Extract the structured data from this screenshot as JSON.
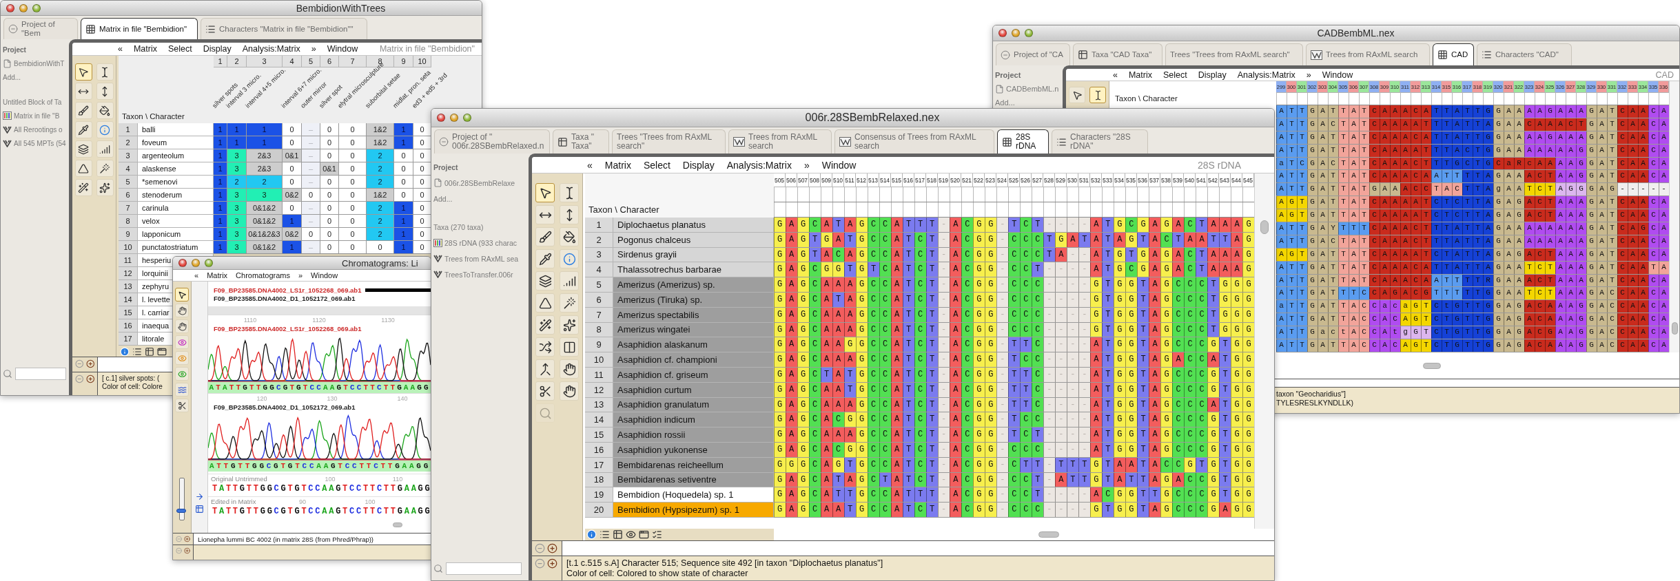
{
  "bembidion_window": {
    "title": "BembidionWithTrees",
    "tabs": [
      {
        "kind": "project",
        "label": "Project of \"Bem",
        "selected": false
      },
      {
        "kind": "matrix",
        "label": "Matrix in file \"Bembidion\"",
        "selected": true
      },
      {
        "kind": "characters",
        "label": "Characters \"Matrix in file \"Bembidion\"\"",
        "selected": false
      }
    ],
    "project_pane": [
      {
        "kind": "title",
        "label": "Project"
      },
      {
        "kind": "file",
        "label": "BembidionWithT"
      },
      {
        "kind": "add",
        "label": "Add..."
      },
      {
        "kind": "heading",
        "label": "Untitled Block of Ta"
      },
      {
        "kind": "matrix",
        "label": "Matrix in file \"B"
      },
      {
        "kind": "trees",
        "label": "All Rerootings o"
      },
      {
        "kind": "trees",
        "label": "All 545 MPTs (54"
      }
    ],
    "menu": {
      "items": [
        "«",
        "Matrix",
        "Select",
        "Display",
        "Analysis:Matrix",
        "»",
        "Window"
      ],
      "label": "Matrix in file \"Bembidion\""
    },
    "tools": [
      {
        "selected": true
      },
      {
        "selected": false
      },
      {
        "selected": false
      },
      {
        "selected": false
      },
      {
        "selected": false
      },
      {
        "selected": false
      },
      {
        "selected": false
      },
      {
        "selected": false
      },
      {
        "selected": false
      },
      {
        "selected": false
      },
      {
        "selected": false
      },
      {
        "selected": false
      },
      {
        "selected": false
      },
      {
        "selected": false
      }
    ],
    "matrix": {
      "corner": "Taxon \\ Character",
      "columns": [
        {
          "number": "1",
          "name": "silver spots"
        },
        {
          "number": "2",
          "name": "interval 3 micro."
        },
        {
          "number": "3",
          "name": "interval 4+5 micro."
        },
        {
          "number": "4",
          "name": "interval 6+7 micro."
        },
        {
          "number": "5",
          "name": "outer mirror"
        },
        {
          "number": "6",
          "name": "silver spot"
        },
        {
          "number": "7",
          "name": "elytral microsculpture"
        },
        {
          "number": "8",
          "name": "suborbital setae"
        },
        {
          "number": "9",
          "name": "midlat. pron. seta"
        },
        {
          "number": "10",
          "name": "ed3 + ed5 + 3rd"
        }
      ],
      "rows": [
        {
          "number": "1",
          "name": "balli",
          "cells": [
            "1",
            "1",
            "1",
            "0",
            "–",
            "0",
            "0",
            "1&2",
            "1",
            "0"
          ]
        },
        {
          "number": "2",
          "name": "foveum",
          "cells": [
            "1",
            "1",
            "1",
            "0",
            "–",
            "0",
            "0",
            "1&2",
            "1",
            "0"
          ]
        },
        {
          "number": "3",
          "name": "argenteolum",
          "cells": [
            "1",
            "3",
            "2&3",
            "0&1",
            "–",
            "0",
            "0",
            "2",
            "0",
            "0"
          ]
        },
        {
          "number": "4",
          "name": "alaskense",
          "cells": [
            "1",
            "3",
            "2&3",
            "0",
            "–",
            "0&1",
            "0",
            "2",
            "0",
            "0"
          ]
        },
        {
          "number": "5",
          "name": "*semenovi",
          "cells": [
            "1",
            "2",
            "2",
            "0",
            "–",
            "0",
            "0",
            "2",
            "0",
            "0"
          ]
        },
        {
          "number": "6",
          "name": "stenoderum",
          "cells": [
            "1",
            "3",
            "3",
            "0&2",
            "0",
            "0",
            "0",
            "1&2",
            "0",
            "0"
          ]
        },
        {
          "number": "7",
          "name": "carinula",
          "cells": [
            "1",
            "3",
            "0&1&2",
            "0",
            "–",
            "0",
            "0",
            "2",
            "1",
            "0"
          ]
        },
        {
          "number": "8",
          "name": "velox",
          "cells": [
            "1",
            "3",
            "0&1&2",
            "1",
            "–",
            "0",
            "0",
            "2",
            "1",
            "0"
          ]
        },
        {
          "number": "9",
          "name": "lapponicum",
          "cells": [
            "1",
            "3",
            "0&1&2&3",
            "0&2",
            "0",
            "0",
            "0",
            "2",
            "1",
            "0"
          ]
        },
        {
          "number": "10",
          "name": "punctatostriatum",
          "cells": [
            "1",
            "3",
            "0&1&2",
            "1",
            "–",
            "0",
            "0",
            "0",
            "1",
            "0"
          ]
        },
        {
          "number": "11",
          "name": "hesperiu"
        },
        {
          "number": "12",
          "name": "lorquinii"
        },
        {
          "number": "13",
          "name": "zephyru"
        },
        {
          "number": "14",
          "name": "l. levette"
        },
        {
          "number": "15",
          "name": "l. carriar"
        },
        {
          "number": "16",
          "name": "inaequa"
        },
        {
          "number": "17",
          "name": "litorale"
        }
      ]
    },
    "status": [
      "[ c.1] silver spots:  (",
      "Color of cell: Colore"
    ]
  },
  "chromatogram_window": {
    "title": "Chromatograms: Li",
    "menu": {
      "items": [
        "«",
        "Matrix",
        "Chromatograms",
        "»",
        "Window"
      ]
    },
    "tools": [
      {
        "selected": true
      },
      {
        "selected": false
      },
      {
        "selected": false
      },
      {
        "selected": false
      },
      {
        "selected": false
      },
      {
        "selected": false
      },
      {
        "selected": false
      },
      {
        "selected": false
      }
    ],
    "zoom_slider": {
      "level": 0.22
    },
    "files": [
      {
        "name": "F09_BP23585.DNA4002_LS1r_1052268_069.ab1",
        "color": "#cc2a2a"
      },
      {
        "name": "F09_BP23585.DNA4002_D1_1052172_069.ab1",
        "color": "#1e1e1e"
      }
    ],
    "traces": [
      {
        "label": "F09_BP23585.DNA4002_LS1r_1052268_069.ab1",
        "color": "#cc2a2a",
        "ticks": [
          "1110",
          "1120",
          "1130"
        ],
        "bases": "ATATTGTTGGCGTGTCCAAGTCCTTCTTGAAGG"
      },
      {
        "label": "F09_BP23585.DNA4002_D1_1052172_069.ab1",
        "color": "#1e1e1e",
        "ticks": [
          "120",
          "130",
          "140"
        ],
        "bases": "ATTGTTGGCGTGTCCAAGTCCTTCTTGAAGG"
      }
    ],
    "sequences": [
      {
        "label": "Original Untrimmed",
        "ticks": [
          "100",
          "110"
        ],
        "bases": "TATTGTTGGCGTGTCCAAGTCCTTCTTGAAGG"
      },
      {
        "label": "Edited in Matrix",
        "ticks": [
          "90",
          "100"
        ],
        "bases": "TATTGTTGGCGTGTCCAAGTCCTTCTTGAAGG"
      }
    ],
    "status": "Lionepha lummi BC 4002 (in matrix 28S (from Phred/Phrap))"
  },
  "rdna_window": {
    "title": "006r.28SBembRelaxed.nex",
    "tabs": [
      {
        "kind": "project",
        "label": "Project of \" 006r.28SBembRelaxed.n",
        "selected": false
      },
      {
        "kind": "taxa",
        "label": "Taxa \" Taxa\"",
        "selected": false
      },
      {
        "kind": "trees",
        "label": "Trees \"Trees from RAxML search\"",
        "selected": false
      },
      {
        "kind": "tree_window",
        "label": "Trees from RAxML search",
        "selected": false
      },
      {
        "kind": "tree_window",
        "label": "Consensus of Trees from RAxML search",
        "selected": false
      },
      {
        "kind": "matrix",
        "label": "28S rDNA",
        "selected": true
      },
      {
        "kind": "characters",
        "label": "Characters \"28S rDNA\"",
        "selected": false
      }
    ],
    "project_pane": [
      {
        "kind": "title",
        "label": "Project"
      },
      {
        "kind": "file",
        "label": "006r.28SBembRelaxe"
      },
      {
        "kind": "add",
        "label": "Add..."
      },
      {
        "kind": "heading",
        "label": "Taxa (270 taxa)"
      },
      {
        "kind": "matrix",
        "label": "28S rDNA (933 charac"
      },
      {
        "kind": "trees",
        "label": "Trees from RAxML sea"
      },
      {
        "kind": "trees",
        "label": "TreesToTransfer.006r"
      }
    ],
    "menu": {
      "items": [
        "«",
        "Matrix",
        "Select",
        "Display",
        "Analysis:Matrix",
        "»",
        "Window"
      ],
      "label": "28S rDNA"
    },
    "tools": [
      {
        "selected": true,
        "disabled": false
      },
      {
        "selected": false,
        "disabled": false
      },
      {
        "selected": false,
        "disabled": false
      },
      {
        "selected": false,
        "disabled": false
      },
      {
        "selected": false,
        "disabled": false
      },
      {
        "selected": false,
        "disabled": false
      },
      {
        "selected": false,
        "disabled": false
      },
      {
        "selected": false,
        "disabled": false
      },
      {
        "selected": false,
        "disabled": false
      },
      {
        "selected": false,
        "disabled": false
      },
      {
        "selected": false,
        "disabled": false
      },
      {
        "selected": false,
        "disabled": false
      },
      {
        "selected": false,
        "disabled": false
      },
      {
        "selected": false,
        "disabled": false
      },
      {
        "selected": false,
        "disabled": false
      },
      {
        "selected": false,
        "disabled": false
      },
      {
        "selected": false,
        "disabled": false
      },
      {
        "selected": false,
        "disabled": false
      },
      {
        "selected": false,
        "disabled": false
      },
      {
        "selected": false,
        "disabled": false
      },
      {
        "selected": false,
        "disabled": true
      }
    ],
    "matrix": {
      "corner": "Taxon \\ Character",
      "column_numbers": [
        "505",
        "506",
        "507",
        "508",
        "509",
        "510",
        "511",
        "512",
        "513",
        "514",
        "515",
        "516",
        "517",
        "518",
        "519",
        "520",
        "521",
        "522",
        "523",
        "524",
        "525",
        "526",
        "527",
        "528",
        "529",
        "530",
        "531",
        "532",
        "533",
        "534",
        "535",
        "536",
        "537",
        "538",
        "539",
        "540",
        "541",
        "542",
        "543",
        "544",
        "545"
      ],
      "rows": [
        {
          "number": "1",
          "name": "Diplochaetus planatus",
          "color": "#d6d6d6",
          "sequence": "GAGCATAGCCATTT-ACGG-TCT----ATGCGAGACTAAAG"
        },
        {
          "number": "2",
          "name": "Pogonus chalceus",
          "color": "#d6d6d6",
          "sequence": "GAGTGATGCCATCT-ACGG-CCCTGATATAGTACTAATTAG"
        },
        {
          "number": "3",
          "name": "Sirdenus grayii",
          "color": "#d6d6d6",
          "sequence": "GAGTACAGCCATCT-ACGG-CCCTA--ATGTGAGACTAAAG"
        },
        {
          "number": "4",
          "name": "Thalassotrechus barbarae",
          "color": "#d6d6d6",
          "sequence": "GAGCGGTGTCATCT-ACGG-CCT----ATGCGAGACTAAAG"
        },
        {
          "number": "5",
          "name": "Amerizus (Amerizus) sp.",
          "color": "#9e9e9e",
          "sequence": "GAGCAAAGCCATCT-ACGG-CCC----GTGGTAGCCCTGGG"
        },
        {
          "number": "6",
          "name": "Amerizus (Tiruka) sp.",
          "color": "#9e9e9e",
          "sequence": "GAGCATAGCCATCT-ACGG-CCC----GTGGTAGCCCTGGG"
        },
        {
          "number": "7",
          "name": "Amerizus spectabilis",
          "color": "#9e9e9e",
          "sequence": "GAGCAAAGCCATCT-ACGG-CCC----GTGGTAGCCCTGGG"
        },
        {
          "number": "8",
          "name": "Amerizus wingatei",
          "color": "#9e9e9e",
          "sequence": "GAGCAAAGCCATCT-ACGG-CCC----GTGGTAGCCCTGGG"
        },
        {
          "number": "9",
          "name": "Asaphidion alaskanum",
          "color": "#9e9e9e",
          "sequence": "GAGCAAGGCCATCT-ACGG-TTC----ATGGTAGCCCGTGG"
        },
        {
          "number": "10",
          "name": "Asaphidion cf. championi",
          "color": "#9e9e9e",
          "sequence": "GAGCAAAGCCATCT-ACGG-TCC----ATGGTAGACCATGG"
        },
        {
          "number": "11",
          "name": "Asaphidion cf. griseum",
          "color": "#9e9e9e",
          "sequence": "GAGCTATGCCATCT-ACGG-TTC----ATGGTAGCCCGTGG"
        },
        {
          "number": "12",
          "name": "Asaphidion curtum",
          "color": "#9e9e9e",
          "sequence": "GAGCAATGCCATCT-ACGG-TTC----ATGGTAGCCCGTGG"
        },
        {
          "number": "13",
          "name": "Asaphidion granulatum",
          "color": "#9e9e9e",
          "sequence": "GAGCAAAGCCATCT-ACGG-TTC----ATGGTAGCCCATGG"
        },
        {
          "number": "14",
          "name": "Asaphidion indicum",
          "color": "#9e9e9e",
          "sequence": "GAGCACGGCCATCT-ACGG-TCC----ATGGTAGCCCGTGG"
        },
        {
          "number": "15",
          "name": "Asaphidion rossii",
          "color": "#9e9e9e",
          "sequence": "GAGCAAAGCCATCT-ACGG-TCT----ATGGTAGCCCGTGG"
        },
        {
          "number": "16",
          "name": "Asaphidion yukonense",
          "color": "#9e9e9e",
          "sequence": "GAGCACGGCCATCT-ACGG-CCC----ATGGTAGCCCGTGG"
        },
        {
          "number": "17",
          "name": "Bembidarenas reicheellum",
          "color": "#9e9e9e",
          "sequence": "GGGCAGTGCCATCT-ACGG-CTT-TTTGTAATACCGTGTGG"
        },
        {
          "number": "18",
          "name": "Bembidarenas setiventre",
          "color": "#9e9e9e",
          "sequence": "GAGCATAGCTATCT-ACGG-CCT-ATTGTATTAGACCGTGG"
        },
        {
          "number": "19",
          "name": "Bembidion (Hoquedela) sp. 1",
          "color": "#ffffff",
          "sequence": "GAGCATTGCCATTT-ACGG-CCT----ACGGTTGCCCGTGG"
        },
        {
          "number": "20",
          "name": "Bembidion (Hypsipezum) sp. 1",
          "color": "#f7a900",
          "sequence": "GAGCAATGCCATCT-ACGG-CCC----GTGGTAGCCCGAGG"
        }
      ]
    },
    "status": [
      "[t.1 c.515 s.A] Character 515; Sequence site 492 [in taxon \"Diplochaetus planatus\"]",
      "Color of cell: Colored to show state of character"
    ]
  },
  "cad_window": {
    "title": "CADBembML.nex",
    "tabs": [
      {
        "kind": "project",
        "label": "Project of \"CA",
        "selected": false
      },
      {
        "kind": "taxa",
        "label": "Taxa \"CAD Taxa\"",
        "selected": false
      },
      {
        "kind": "trees",
        "label": "Trees \"Trees from RAxML search\"",
        "selected": false
      },
      {
        "kind": "tree_window",
        "label": "Trees from RAxML search",
        "selected": false
      },
      {
        "kind": "matrix",
        "label": "CAD",
        "selected": true
      },
      {
        "kind": "characters",
        "label": "Characters \"CAD\"",
        "selected": false
      }
    ],
    "project_pane": [
      {
        "kind": "title",
        "label": "Project"
      },
      {
        "kind": "file",
        "label": "CADBembML.n"
      },
      {
        "kind": "add",
        "label": "Add..."
      }
    ],
    "menu": {
      "items": [
        "«",
        "Matrix",
        "Select",
        "Display",
        "Analysis:Matrix",
        "»",
        "Window"
      ],
      "label": "CAD"
    },
    "tools": [
      {
        "selected": false
      },
      {
        "selected": true
      }
    ],
    "matrix": {
      "corner": "Taxon \\ Character",
      "column_numbers": [
        "299",
        "300",
        "301",
        "302",
        "303",
        "304",
        "305",
        "306",
        "307",
        "308",
        "309",
        "310",
        "311",
        "312",
        "313",
        "314",
        "315",
        "316",
        "317",
        "318",
        "319",
        "320",
        "321",
        "322",
        "323",
        "324",
        "325",
        "326",
        "327",
        "328",
        "329",
        "330",
        "331",
        "332",
        "333",
        "334",
        "335",
        "336"
      ],
      "rows": [
        {
          "segments": [
            {
              "bases": "ATT",
              "color": "#5a9cf0"
            },
            {
              "bases": "GAT",
              "color": "#c9b98f"
            },
            {
              "bases": "TAT",
              "color": "#f2a49a"
            },
            {
              "bases": "CAAACA",
              "color": "#c92b1d"
            },
            {
              "bases": "TTATTG",
              "color": "#1541d6"
            },
            {
              "bases": "GAA",
              "color": "#c9b98f"
            },
            {
              "bases": "AAGAAA",
              "color": "#b04cf0"
            },
            {
              "bases": "GAT",
              "color": "#c9b98f"
            },
            {
              "bases": "CAA",
              "color": "#c92b1d"
            },
            {
              "bases": "CA",
              "color": "#b04cf0"
            }
          ]
        },
        {
          "segments": [
            {
              "bases": "ATT",
              "color": "#5a9cf0"
            },
            {
              "bases": "GAC",
              "color": "#c9b98f"
            },
            {
              "bases": "TAT",
              "color": "#f2a49a"
            },
            {
              "bases": "CAAAAT",
              "color": "#c92b1d"
            },
            {
              "bases": "TTATTA",
              "color": "#1541d6"
            },
            {
              "bases": "GAA",
              "color": "#c9b98f"
            },
            {
              "bases": "CAAACT",
              "color": "#c92b1d"
            },
            {
              "bases": "GAT",
              "color": "#c9b98f"
            },
            {
              "bases": "CAA",
              "color": "#c92b1d"
            },
            {
              "bases": "CA",
              "color": "#b04cf0"
            }
          ]
        },
        {
          "segments": [
            {
              "bases": "ATT",
              "color": "#5a9cf0"
            },
            {
              "bases": "GAT",
              "color": "#c9b98f"
            },
            {
              "bases": "TAT",
              "color": "#f2a49a"
            },
            {
              "bases": "CAAACA",
              "color": "#c92b1d"
            },
            {
              "bases": "TTATTG",
              "color": "#1541d6"
            },
            {
              "bases": "GAA",
              "color": "#c9b98f"
            },
            {
              "bases": "AAGAAA",
              "color": "#b04cf0"
            },
            {
              "bases": "GAT",
              "color": "#c9b98f"
            },
            {
              "bases": "CAA",
              "color": "#c92b1d"
            },
            {
              "bases": "CA",
              "color": "#b04cf0"
            }
          ]
        },
        {
          "segments": [
            {
              "bases": "ATT",
              "color": "#5a9cf0"
            },
            {
              "bases": "GAT",
              "color": "#c9b98f"
            },
            {
              "bases": "TAT",
              "color": "#f2a49a"
            },
            {
              "bases": "CAAAAT",
              "color": "#c92b1d"
            },
            {
              "bases": "TTACTG",
              "color": "#1541d6"
            },
            {
              "bases": "GAA",
              "color": "#c9b98f"
            },
            {
              "bases": "AAAAAG",
              "color": "#b04cf0"
            },
            {
              "bases": "GAT",
              "color": "#c9b98f"
            },
            {
              "bases": "CAA",
              "color": "#c92b1d"
            },
            {
              "bases": "CA",
              "color": "#b04cf0"
            }
          ]
        },
        {
          "segments": [
            {
              "bases": "aTC",
              "color": "#5a9cf0"
            },
            {
              "bases": "GAC",
              "color": "#c9b98f"
            },
            {
              "bases": "TAT",
              "color": "#f2a49a"
            },
            {
              "bases": "CAAACT",
              "color": "#c92b1d"
            },
            {
              "bases": "TTGCTG",
              "color": "#1541d6"
            },
            {
              "bases": "CaRcAA",
              "color": "#c92b1d"
            },
            {
              "bases": "AAG",
              "color": "#b04cf0"
            },
            {
              "bases": "GAT",
              "color": "#c9b98f"
            },
            {
              "bases": "CAA",
              "color": "#c92b1d"
            },
            {
              "bases": "CA",
              "color": "#b04cf0"
            }
          ]
        },
        {
          "segments": [
            {
              "bases": "ATT",
              "color": "#5a9cf0"
            },
            {
              "bases": "GAT",
              "color": "#c9b98f"
            },
            {
              "bases": "TAT",
              "color": "#f2a49a"
            },
            {
              "bases": "CAAACA",
              "color": "#c92b1d"
            },
            {
              "bases": "ATT",
              "color": "#5a9cf0"
            },
            {
              "bases": "TTA",
              "color": "#1541d6"
            },
            {
              "bases": "GAA",
              "color": "#c9b98f"
            },
            {
              "bases": "ACT",
              "color": "#c92b1d"
            },
            {
              "bases": "AAG",
              "color": "#b04cf0"
            },
            {
              "bases": "GAT",
              "color": "#c9b98f"
            },
            {
              "bases": "CAA",
              "color": "#c92b1d"
            },
            {
              "bases": "CA",
              "color": "#b04cf0"
            }
          ]
        },
        {
          "segments": [
            {
              "bases": "ATT",
              "color": "#5a9cf0"
            },
            {
              "bases": "GAT",
              "color": "#c9b98f"
            },
            {
              "bases": "TAT",
              "color": "#f2a49a"
            },
            {
              "bases": "GAA",
              "color": "#c9b98f"
            },
            {
              "bases": "ACC",
              "color": "#c92b1d"
            },
            {
              "bases": "TAC",
              "color": "#f2a49a"
            },
            {
              "bases": "TTA",
              "color": "#1541d6"
            },
            {
              "bases": "gAA",
              "color": "#c9b98f"
            },
            {
              "bases": "TCT",
              "color": "#f4d600"
            },
            {
              "bases": "AGG",
              "color": "#dcb6ee"
            },
            {
              "bases": "GAG",
              "color": "#c9b98f"
            },
            {
              "bases": "-----",
              "color": "#f1efef"
            }
          ]
        },
        {
          "segments": [
            {
              "bases": "AGT",
              "color": "#f4d600"
            },
            {
              "bases": "GAT",
              "color": "#c9b98f"
            },
            {
              "bases": "TAT",
              "color": "#f2a49a"
            },
            {
              "bases": "CAAAAT",
              "color": "#c92b1d"
            },
            {
              "bases": "CTCTTA",
              "color": "#1541d6"
            },
            {
              "bases": "GAG",
              "color": "#c9b98f"
            },
            {
              "bases": "ACT",
              "color": "#c92b1d"
            },
            {
              "bases": "AAA",
              "color": "#b04cf0"
            },
            {
              "bases": "GAT",
              "color": "#c9b98f"
            },
            {
              "bases": "CAA",
              "color": "#c92b1d"
            },
            {
              "bases": "CA",
              "color": "#b04cf0"
            }
          ]
        },
        {
          "segments": [
            {
              "bases": "AGT",
              "color": "#f4d600"
            },
            {
              "bases": "GAT",
              "color": "#c9b98f"
            },
            {
              "bases": "TAT",
              "color": "#f2a49a"
            },
            {
              "bases": "CAAAAT",
              "color": "#c92b1d"
            },
            {
              "bases": "CTCTTA",
              "color": "#1541d6"
            },
            {
              "bases": "GAG",
              "color": "#c9b98f"
            },
            {
              "bases": "ACT",
              "color": "#c92b1d"
            },
            {
              "bases": "AAA",
              "color": "#b04cf0"
            },
            {
              "bases": "GAT",
              "color": "#c9b98f"
            },
            {
              "bases": "CAA",
              "color": "#c92b1d"
            },
            {
              "bases": "CA",
              "color": "#b04cf0"
            }
          ]
        },
        {
          "segments": [
            {
              "bases": "ATT",
              "color": "#5a9cf0"
            },
            {
              "bases": "GAY",
              "color": "#c9b98f"
            },
            {
              "bases": "TTT",
              "color": "#5a9cf0"
            },
            {
              "bases": "CAAACT",
              "color": "#c92b1d"
            },
            {
              "bases": "TTATTA",
              "color": "#1541d6"
            },
            {
              "bases": "GAA",
              "color": "#c9b98f"
            },
            {
              "bases": "AAAAAA",
              "color": "#b04cf0"
            },
            {
              "bases": "GAT",
              "color": "#c9b98f"
            },
            {
              "bases": "CAG",
              "color": "#c92b1d"
            },
            {
              "bases": "CA",
              "color": "#b04cf0"
            }
          ]
        },
        {
          "segments": [
            {
              "bases": "ATT",
              "color": "#5a9cf0"
            },
            {
              "bases": "GAC",
              "color": "#c9b98f"
            },
            {
              "bases": "TAT",
              "color": "#f2a49a"
            },
            {
              "bases": "CAAACT",
              "color": "#c92b1d"
            },
            {
              "bases": "TTATTA",
              "color": "#1541d6"
            },
            {
              "bases": "GAA",
              "color": "#c9b98f"
            },
            {
              "bases": "AAAAAA",
              "color": "#b04cf0"
            },
            {
              "bases": "GAT",
              "color": "#c9b98f"
            },
            {
              "bases": "CAA",
              "color": "#c92b1d"
            },
            {
              "bases": "CA",
              "color": "#b04cf0"
            }
          ]
        },
        {
          "segments": [
            {
              "bases": "AGT",
              "color": "#f4d600"
            },
            {
              "bases": "GAT",
              "color": "#c9b98f"
            },
            {
              "bases": "TAT",
              "color": "#f2a49a"
            },
            {
              "bases": "CAAAAT",
              "color": "#c92b1d"
            },
            {
              "bases": "CTATTA",
              "color": "#1541d6"
            },
            {
              "bases": "GAG",
              "color": "#c9b98f"
            },
            {
              "bases": "ACT",
              "color": "#c92b1d"
            },
            {
              "bases": "AAA",
              "color": "#b04cf0"
            },
            {
              "bases": "GAT",
              "color": "#c9b98f"
            },
            {
              "bases": "CAA",
              "color": "#c92b1d"
            },
            {
              "bases": "CA",
              "color": "#b04cf0"
            }
          ]
        },
        {
          "segments": [
            {
              "bases": "ATT",
              "color": "#5a9cf0"
            },
            {
              "bases": "GAT",
              "color": "#c9b98f"
            },
            {
              "bases": "TAT",
              "color": "#f2a49a"
            },
            {
              "bases": "CAAACA",
              "color": "#c92b1d"
            },
            {
              "bases": "TTATTA",
              "color": "#1541d6"
            },
            {
              "bases": "GAA",
              "color": "#c9b98f"
            },
            {
              "bases": "TCT",
              "color": "#f4d600"
            },
            {
              "bases": "AAA",
              "color": "#b04cf0"
            },
            {
              "bases": "GAT",
              "color": "#c9b98f"
            },
            {
              "bases": "CAA",
              "color": "#c92b1d"
            },
            {
              "bases": "TA",
              "color": "#f2a49a"
            }
          ]
        },
        {
          "segments": [
            {
              "bases": "ATT",
              "color": "#5a9cf0"
            },
            {
              "bases": "GAT",
              "color": "#c9b98f"
            },
            {
              "bases": "TAT",
              "color": "#f2a49a"
            },
            {
              "bases": "CAAACA",
              "color": "#c92b1d"
            },
            {
              "bases": "ATT",
              "color": "#5a9cf0"
            },
            {
              "bases": "TTR",
              "color": "#1541d6"
            },
            {
              "bases": "GAA",
              "color": "#c9b98f"
            },
            {
              "bases": "ACT",
              "color": "#c92b1d"
            },
            {
              "bases": "AAA",
              "color": "#b04cf0"
            },
            {
              "bases": "GAT",
              "color": "#c9b98f"
            },
            {
              "bases": "CAA",
              "color": "#c92b1d"
            },
            {
              "bases": "CA",
              "color": "#b04cf0"
            }
          ]
        },
        {
          "segments": [
            {
              "bases": "ATT",
              "color": "#5a9cf0"
            },
            {
              "bases": "GAT",
              "color": "#c9b98f"
            },
            {
              "bases": "TTC",
              "color": "#5a9cf0"
            },
            {
              "bases": "CAGACG",
              "color": "#c92b1d"
            },
            {
              "bases": "TTT",
              "color": "#5a9cf0"
            },
            {
              "bases": "TTG",
              "color": "#1541d6"
            },
            {
              "bases": "GAA",
              "color": "#c9b98f"
            },
            {
              "bases": "TCT",
              "color": "#f4d600"
            },
            {
              "bases": "AAA",
              "color": "#b04cf0"
            },
            {
              "bases": "GAC",
              "color": "#c9b98f"
            },
            {
              "bases": "CAA",
              "color": "#c92b1d"
            },
            {
              "bases": "CA",
              "color": "#b04cf0"
            }
          ]
        },
        {
          "segments": [
            {
              "bases": "aTT",
              "color": "#5a9cf0"
            },
            {
              "bases": "GAT",
              "color": "#c9b98f"
            },
            {
              "bases": "TAC",
              "color": "#f2a49a"
            },
            {
              "bases": "Cac",
              "color": "#b04cf0"
            },
            {
              "bases": "aGT",
              "color": "#f4d600"
            },
            {
              "bases": "CtGTTG",
              "color": "#1541d6"
            },
            {
              "bases": "GAG",
              "color": "#c9b98f"
            },
            {
              "bases": "ACA",
              "color": "#c92b1d"
            },
            {
              "bases": "AAG",
              "color": "#b04cf0"
            },
            {
              "bases": "GAC",
              "color": "#c9b98f"
            },
            {
              "bases": "CAA",
              "color": "#c92b1d"
            },
            {
              "bases": "CA",
              "color": "#b04cf0"
            }
          ]
        },
        {
          "segments": [
            {
              "bases": "ATT",
              "color": "#5a9cf0"
            },
            {
              "bases": "GAT",
              "color": "#c9b98f"
            },
            {
              "bases": "TAC",
              "color": "#f2a49a"
            },
            {
              "bases": "CAC",
              "color": "#b04cf0"
            },
            {
              "bases": "AGT",
              "color": "#f4d600"
            },
            {
              "bases": "CTGTTG",
              "color": "#1541d6"
            },
            {
              "bases": "GAG",
              "color": "#c9b98f"
            },
            {
              "bases": "ACA",
              "color": "#c92b1d"
            },
            {
              "bases": "AAG",
              "color": "#b04cf0"
            },
            {
              "bases": "GAC",
              "color": "#c9b98f"
            },
            {
              "bases": "CAA",
              "color": "#c92b1d"
            },
            {
              "bases": "CA",
              "color": "#b04cf0"
            }
          ]
        },
        {
          "segments": [
            {
              "bases": "ATT",
              "color": "#5a9cf0"
            },
            {
              "bases": "Gac",
              "color": "#c9b98f"
            },
            {
              "bases": "tAC",
              "color": "#f2a49a"
            },
            {
              "bases": "CAt",
              "color": "#b04cf0"
            },
            {
              "bases": "gGT",
              "color": "#dcb6ee"
            },
            {
              "bases": "CTGTTG",
              "color": "#1541d6"
            },
            {
              "bases": "GAG",
              "color": "#c9b98f"
            },
            {
              "bases": "ACG",
              "color": "#c92b1d"
            },
            {
              "bases": "AAG",
              "color": "#b04cf0"
            },
            {
              "bases": "GAC",
              "color": "#c9b98f"
            },
            {
              "bases": "CAA",
              "color": "#c92b1d"
            },
            {
              "bases": "CA",
              "color": "#b04cf0"
            }
          ]
        },
        {
          "segments": [
            {
              "bases": "ATT",
              "color": "#5a9cf0"
            },
            {
              "bases": "GAT",
              "color": "#c9b98f"
            },
            {
              "bases": "TAC",
              "color": "#f2a49a"
            },
            {
              "bases": "CAC",
              "color": "#b04cf0"
            },
            {
              "bases": "AGT",
              "color": "#f4d600"
            },
            {
              "bases": "CTGTTG",
              "color": "#1541d6"
            },
            {
              "bases": "GAG",
              "color": "#c9b98f"
            },
            {
              "bases": "ACA",
              "color": "#c92b1d"
            },
            {
              "bases": "AAG",
              "color": "#b04cf0"
            },
            {
              "bases": "GAC",
              "color": "#c9b98f"
            },
            {
              "bases": "CAA",
              "color": "#c92b1d"
            },
            {
              "bases": "CA",
              "color": "#b04cf0"
            }
          ]
        }
      ]
    },
    "status": [
      "taxon \"Geocharidius\"]",
      "TYLESRESLKYNDLLK)"
    ]
  }
}
